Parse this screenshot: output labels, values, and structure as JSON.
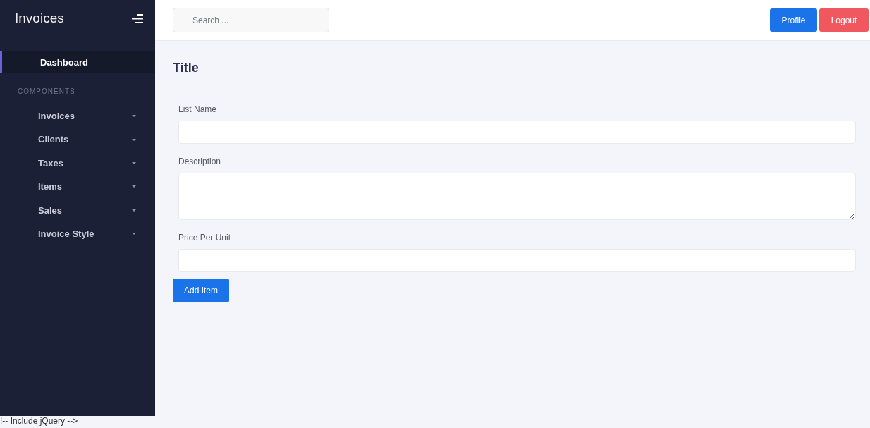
{
  "sidebar": {
    "brand": "Invoices",
    "nav": [
      {
        "label": "Dashboard",
        "selected": true
      }
    ],
    "section_heading": "COMPONENTS",
    "components": [
      {
        "label": "Invoices",
        "selected": false,
        "expanded": false
      },
      {
        "label": "Clients",
        "selected": false,
        "expanded": false
      },
      {
        "label": "Taxes",
        "selected": false,
        "expanded": false
      },
      {
        "label": "Items",
        "selected": false,
        "expanded": false
      },
      {
        "label": "Sales",
        "selected": false,
        "expanded": false
      },
      {
        "label": "Invoice Style",
        "selected": false,
        "expanded": false
      }
    ]
  },
  "header": {
    "search": {
      "placeholder": "Search ..."
    },
    "buttons": [
      {
        "label": "Profile",
        "kind": "primary"
      },
      {
        "label": "Logout",
        "kind": "danger"
      }
    ]
  },
  "main": {
    "title": "Title",
    "fields": [
      {
        "label": "List Name",
        "kind": "input"
      },
      {
        "label": "Description",
        "kind": "textarea"
      },
      {
        "label": "Price Per Unit",
        "kind": "input"
      }
    ],
    "submit": "Add Item"
  },
  "footer_text": "!-- Include jQuery -->"
}
